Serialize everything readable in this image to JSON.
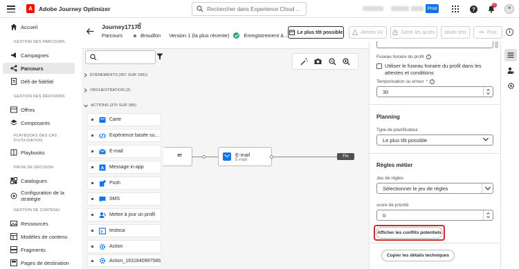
{
  "app": {
    "name": "Adobe Journey Optimizer",
    "logo_letter": "A"
  },
  "topbar": {
    "search_placeholder": "Rechercher dans Experience Cloud ...",
    "env_badge": "Prod",
    "notification_count": "2"
  },
  "nav": {
    "home": "Accueil",
    "sections": [
      {
        "title": "GESTION DES PARCOURS",
        "items": [
          "Campagnes",
          "Parcours",
          "Défi de fidélité"
        ]
      },
      {
        "title": "GESTION DES DÉCISIONS",
        "items": [
          "Offres",
          "Composants"
        ]
      },
      {
        "title": "PLAYBOOKS DES CAS D'UTILISATION",
        "items": [
          "Playbooks"
        ]
      },
      {
        "title": "PRISE DE DÉCISION",
        "items": [
          "Catalogues",
          "Configuration de la stratégie"
        ]
      },
      {
        "title": "GESTION DE CONTENU",
        "items": [
          "Ressources",
          "Modèles de contenu",
          "Fragments",
          "Pages de destination"
        ]
      }
    ],
    "selected": "Parcours"
  },
  "header": {
    "journey_name": "Journey17170",
    "type": "Parcours",
    "status": "Brouillon",
    "version": "Version 1 (la plus récente)",
    "save_status": "Enregistrement à...",
    "buttons": {
      "asap": "Le plus tôt possible",
      "alerts": "Alertes (4)",
      "access": "Gérer les accès",
      "test": "Mode test",
      "more": "Plus"
    }
  },
  "palette": {
    "search_placeholder": "",
    "categories": {
      "events": "ÉVÉNEMENTS (967 SUR 1091)",
      "orchestration": "ORCHESTRATION (2)",
      "actions": "ACTIONS (375 SUR 385)"
    },
    "actions": [
      "Carte",
      "Expérience basée su...",
      "E-mail",
      "Message in-app",
      "Push",
      "SMS",
      "Mettre à jour un profil",
      "testoca",
      "Action",
      "Action_1631840997586"
    ]
  },
  "canvas": {
    "left_node_label": "er",
    "email_node": {
      "title": "E-mail",
      "subtitle": "E-mail"
    },
    "end_node": "Fin"
  },
  "panel": {
    "tz_label": "Fuseau horaire du profil",
    "tz_checkbox": "Utiliser le fuseau horaire du profil dans les attentes et conditions",
    "timeout_label": "Temporisation ou erreur",
    "timeout_value": "30",
    "planning_heading": "Planning",
    "scheduler_type_label": "Type de planificateur",
    "scheduler_type_value": "Le plus tôt possible",
    "rules_heading": "Règles métier",
    "ruleset_label": "Jeu de règles",
    "ruleset_value": "Sélectionner le jeu de règles",
    "priority_label": "score de priorité",
    "priority_value": "0",
    "conflicts_button": "Afficher les conflits potentiels",
    "copy_button": "Copier les détails techniques"
  },
  "colors": {
    "accent": "#1473e6",
    "brand": "#eb1000",
    "highlight": "#c92a2a",
    "success": "#2d9d78"
  }
}
